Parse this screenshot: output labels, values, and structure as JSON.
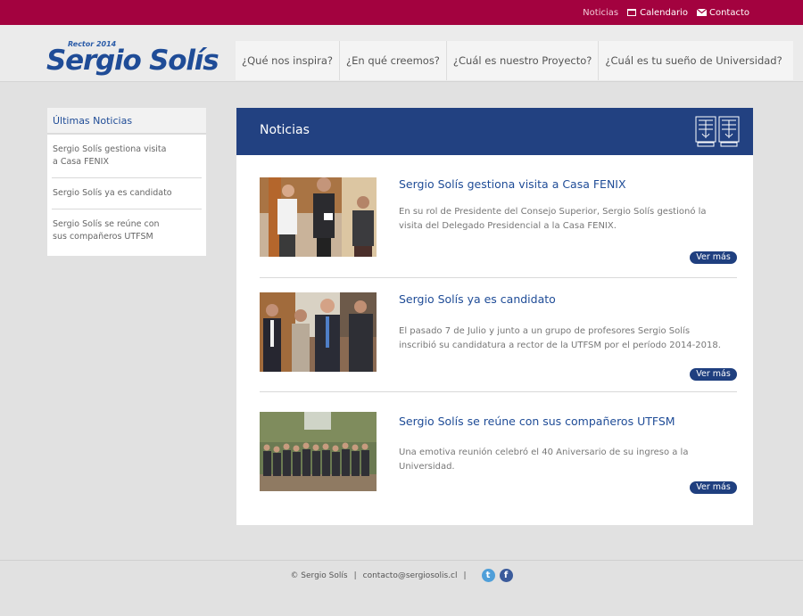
{
  "topbar": {
    "links": [
      {
        "label": "Noticias",
        "icon": "none"
      },
      {
        "label": "Calendario",
        "icon": "calendar-icon"
      },
      {
        "label": "Contacto",
        "icon": "envelope-icon"
      }
    ]
  },
  "header": {
    "logo_tagline": "Rector 2014",
    "logo_name": "Sergio Solís",
    "nav": [
      "¿Qué nos inspira?",
      "¿En qué creemos?",
      "¿Cuál es nuestro Proyecto?",
      "¿Cuál es tu sueño de Universidad?"
    ]
  },
  "sidebar": {
    "title": "Últimas Noticias",
    "items": [
      "Sergio Solís gestiona visita a Casa FENIX",
      "Sergio Solís ya es candidato",
      "Sergio Solís se reúne con sus compañeros UTFSM"
    ]
  },
  "main": {
    "title": "Noticias",
    "news": [
      {
        "title": "Sergio Solís gestiona visita a Casa FENIX",
        "description": "En su rol de Presidente del Consejo Superior, Sergio Solís gestionó la visita del Delegado Presidencial a la Casa FENIX.",
        "more": "Ver más"
      },
      {
        "title": "Sergio Solís ya es candidato",
        "description": "El pasado 7 de Julio y junto a un grupo de profesores Sergio Solís inscribió su candidatura a rector de la UTFSM por el período 2014-2018.",
        "more": "Ver más"
      },
      {
        "title": "Sergio Solís se reúne con sus compañeros UTFSM",
        "description": "Una emotiva reunión celebró el 40 Aniversario de su ingreso a la Universidad.",
        "more": "Ver más"
      }
    ]
  },
  "footer": {
    "copyright": "© Sergio Solís",
    "email": "contacto@sergiosolis.cl",
    "social": [
      "twitter-icon",
      "facebook-icon"
    ]
  },
  "colors": {
    "topbar": "#a3023f",
    "brand_blue": "#224181",
    "link_blue": "#1f4c97",
    "background": "#e1e1e1"
  }
}
